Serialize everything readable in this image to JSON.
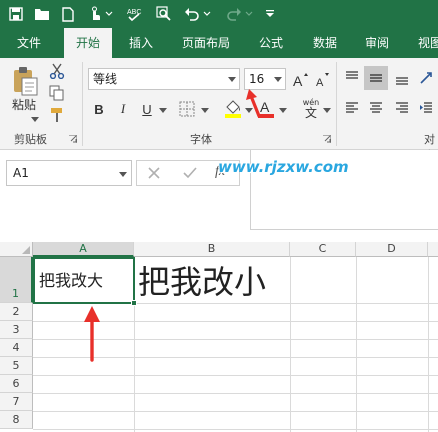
{
  "ribbon_tabs": [
    "文件",
    "开始",
    "插入",
    "页面布局",
    "公式",
    "数据",
    "审阅",
    "视图"
  ],
  "clipboard": {
    "paste_label": "粘贴",
    "group_label": "剪贴板"
  },
  "font": {
    "name": "等线",
    "size": "16",
    "group_label": "字体",
    "bold": "B",
    "italic": "I",
    "underline": "U",
    "pinyin": "wén"
  },
  "alignment": {
    "group_label": "对齐"
  },
  "name_box": "A1",
  "watermark": "www.rjzxw.com",
  "columns": [
    "A",
    "B",
    "C",
    "D"
  ],
  "rows": [
    "1",
    "2",
    "3",
    "4",
    "5",
    "6",
    "7",
    "8"
  ],
  "cells": {
    "A1": "把我改大",
    "B1": "把我改小"
  },
  "colors": {
    "accent": "#217346",
    "arrow": "#e8302a",
    "watermark": "#2aa7e0"
  }
}
